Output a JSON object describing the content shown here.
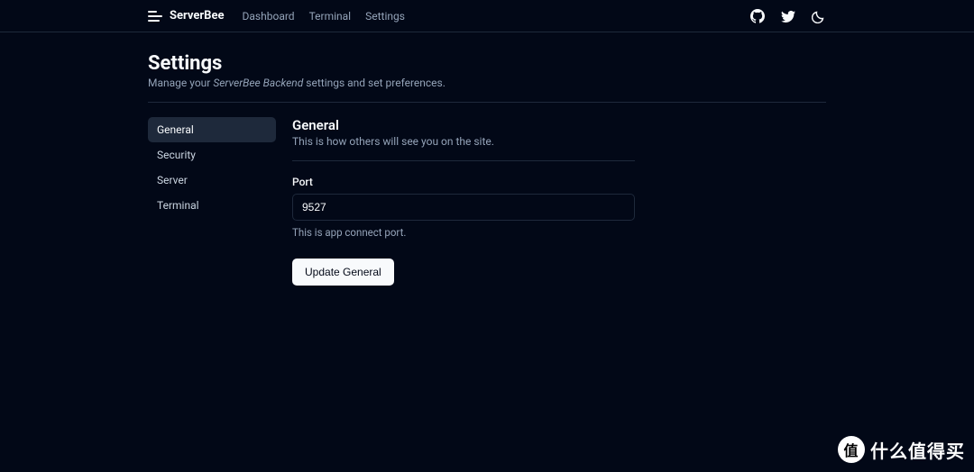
{
  "brand": "ServerBee",
  "nav": {
    "dashboard": "Dashboard",
    "terminal": "Terminal",
    "settings": "Settings"
  },
  "page": {
    "title": "Settings",
    "subtitle_pre": "Manage your ",
    "subtitle_em": "ServerBee Backend",
    "subtitle_post": " settings and set preferences."
  },
  "sidebar": {
    "general": "General",
    "security": "Security",
    "server": "Server",
    "terminal": "Terminal"
  },
  "section": {
    "title": "General",
    "desc": "This is how others will see you on the site."
  },
  "port_field": {
    "label": "Port",
    "value": "9527",
    "help": "This is app connect port."
  },
  "button": {
    "update": "Update General"
  },
  "watermark": {
    "badge": "值",
    "text": "什么值得买"
  }
}
